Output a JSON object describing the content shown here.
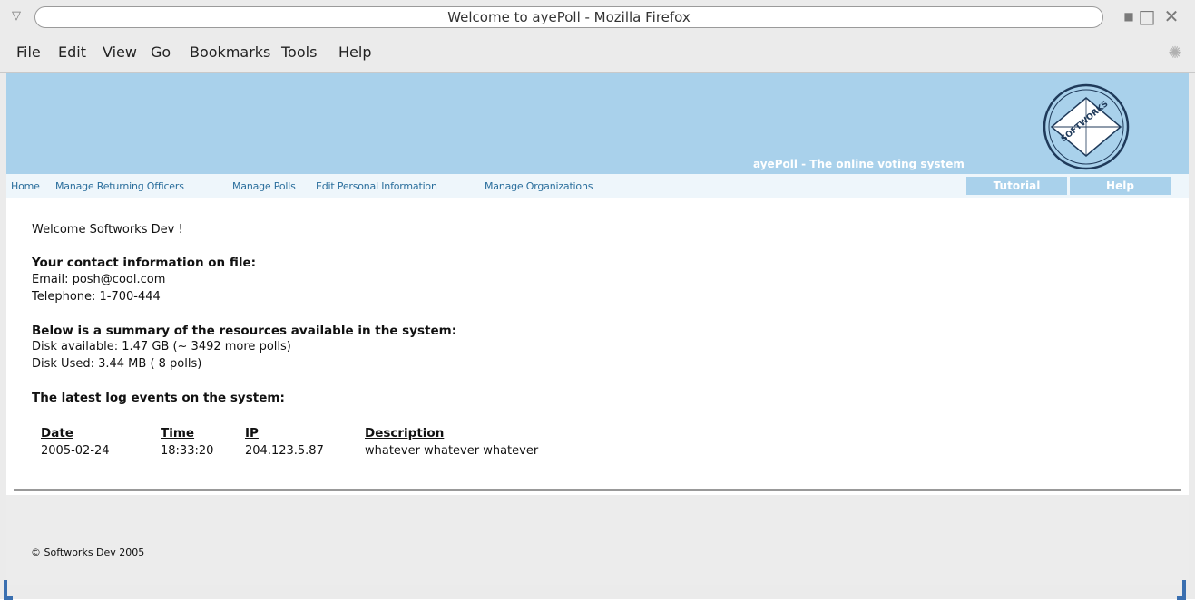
{
  "window": {
    "title": "Welcome to ayePoll - Mozilla Firefox",
    "menu_icon": "triangle-down-icon",
    "minimize_icon": "minimize-icon",
    "maximize_icon": "maximize-icon",
    "close_icon": "close-icon"
  },
  "menubar": {
    "items": [
      "File",
      "Edit",
      "View",
      "Go",
      "Bookmarks",
      "Tools",
      "Help"
    ],
    "throbber_icon": "throbber-icon"
  },
  "banner": {
    "tagline": "ayePoll - The online voting system",
    "logo_icon": "ayepoll-logo",
    "logo_text": "SOFTWORKS",
    "bg_color": "#a9d1eb"
  },
  "nav": {
    "links": [
      "Home",
      "Manage Returning Officers",
      "Manage Polls",
      "Edit Personal Information",
      "Manage Organizations"
    ],
    "buttons": [
      "Tutorial",
      "Help"
    ],
    "link_color": "#2a6e9c"
  },
  "main": {
    "welcome": "Welcome Softworks Dev !",
    "contact_heading": "Your contact information on file:",
    "email": "Email: posh@cool.com",
    "telephone": "Telephone: 1-700-444",
    "resources_heading": "Below is a summary of the resources available in the system:",
    "disk_available": "Disk available: 1.47 GB (~ 3492 more polls)",
    "disk_used": "Disk Used: 3.44 MB ( 8 polls)",
    "log_heading": "The latest log events on the system:",
    "log_table": {
      "headers": [
        "Date",
        "Time",
        "IP",
        "Description"
      ],
      "rows": [
        [
          "2005-02-24",
          "18:33:20",
          "204.123.5.87",
          "whatever whatever whatever"
        ]
      ]
    }
  },
  "footer": {
    "text": "© Softworks Dev 2005"
  }
}
